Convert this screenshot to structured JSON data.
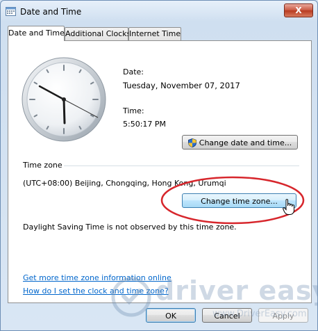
{
  "window": {
    "title": "Date and Time",
    "close_label": "X"
  },
  "tabs": [
    {
      "label": "Date and Time",
      "active": true
    },
    {
      "label": "Additional Clocks",
      "active": false
    },
    {
      "label": "Internet Time",
      "active": false
    }
  ],
  "datetime": {
    "date_label": "Date:",
    "date_value": "Tuesday, November 07, 2017",
    "time_label": "Time:",
    "time_value": "5:50:17 PM",
    "change_datetime_button": "Change date and time..."
  },
  "timezone": {
    "heading": "Time zone",
    "value": "(UTC+08:00) Beijing, Chongqing, Hong Kong, Urumqi",
    "change_button": "Change time zone...",
    "dst_note": "Daylight Saving Time is not observed by this time zone."
  },
  "links": {
    "more_info": "Get more time zone information online",
    "how_to": "How do I set the clock and time zone?"
  },
  "footer": {
    "ok": "OK",
    "cancel": "Cancel",
    "apply": "Apply"
  },
  "watermark": {
    "brand": "driver easy",
    "url": "www.DriverEasy.com"
  },
  "colors": {
    "link": "#0066cc",
    "highlight_ring": "#d7262c",
    "accent_border": "#3c7fb1"
  }
}
